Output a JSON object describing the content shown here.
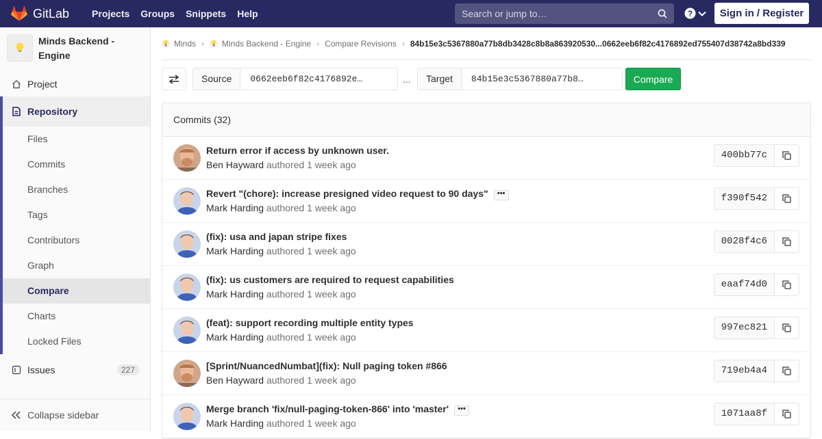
{
  "navbar": {
    "brand": "GitLab",
    "links": [
      "Projects",
      "Groups",
      "Snippets",
      "Help"
    ],
    "search_placeholder": "Search or jump to…",
    "signin": "Sign in / Register"
  },
  "sidebar": {
    "project_name": "Minds Backend - Engine",
    "project": "Project",
    "repository": "Repository",
    "repo_items": [
      "Files",
      "Commits",
      "Branches",
      "Tags",
      "Contributors",
      "Graph",
      "Compare",
      "Charts",
      "Locked Files"
    ],
    "issues": "Issues",
    "issues_count": "227",
    "collapse": "Collapse sidebar"
  },
  "breadcrumbs": [
    "Minds",
    "Minds Backend - Engine",
    "Compare Revisions",
    "84b15e3c5367880a77b8db3428c8b8a863920530...0662eeb6f82c4176892ed755407d38742a8bd339"
  ],
  "compare": {
    "source_label": "Source",
    "source_value": "0662eeb6f82c4176892e…",
    "dots": "...",
    "target_label": "Target",
    "target_value": "84b15e3c5367880a77b8…",
    "button": "Compare"
  },
  "commits_header": "Commits (32)",
  "commits": [
    {
      "title": "Return error if access by unknown user.",
      "author": "Ben Hayward",
      "verb": "authored",
      "time": "1 week ago",
      "sha": "400bb77c",
      "more": false
    },
    {
      "title": "Revert \"(chore): increase presigned video request to 90 days\"",
      "author": "Mark Harding",
      "verb": "authored",
      "time": "1 week ago",
      "sha": "f390f542",
      "more": true
    },
    {
      "title": "(fix): usa and japan stripe fixes",
      "author": "Mark Harding",
      "verb": "authored",
      "time": "1 week ago",
      "sha": "0028f4c6",
      "more": false
    },
    {
      "title": "(fix): us customers are required to request capabilities",
      "author": "Mark Harding",
      "verb": "authored",
      "time": "1 week ago",
      "sha": "eaaf74d0",
      "more": false
    },
    {
      "title": "(feat): support recording multiple entity types",
      "author": "Mark Harding",
      "verb": "authored",
      "time": "1 week ago",
      "sha": "997ec821",
      "more": false
    },
    {
      "title": "[Sprint/NuancedNumbat](fix): Null paging token #866",
      "author": "Ben Hayward",
      "verb": "authored",
      "time": "1 week ago",
      "sha": "719eb4a4",
      "more": false
    },
    {
      "title": "Merge branch 'fix/null-paging-token-866' into 'master'",
      "author": "Mark Harding",
      "verb": "authored",
      "time": "1 week ago",
      "sha": "1071aa8f",
      "more": true
    }
  ]
}
